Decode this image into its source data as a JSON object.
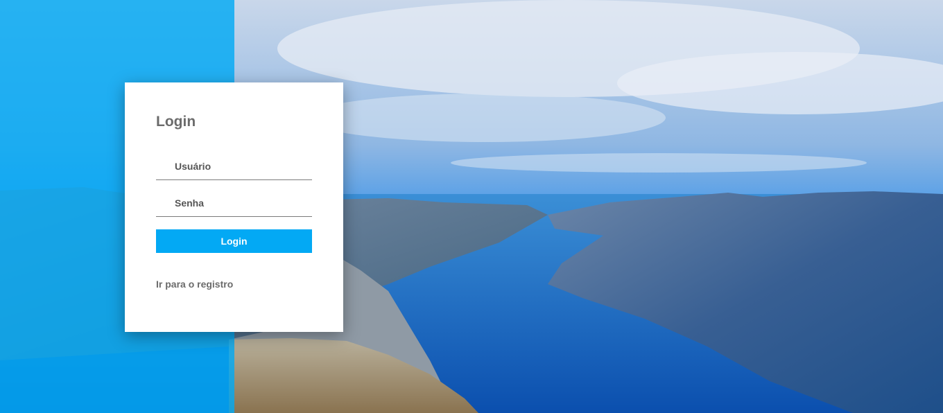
{
  "login": {
    "title": "Login",
    "username_placeholder": "Usuário",
    "username_value": "",
    "password_placeholder": "Senha",
    "password_value": "",
    "submit_label": "Login",
    "register_link": "Ir para o registro"
  },
  "colors": {
    "accent": "#03a9f4",
    "card_background": "#ffffff",
    "label_text": "#6b6b6b"
  }
}
